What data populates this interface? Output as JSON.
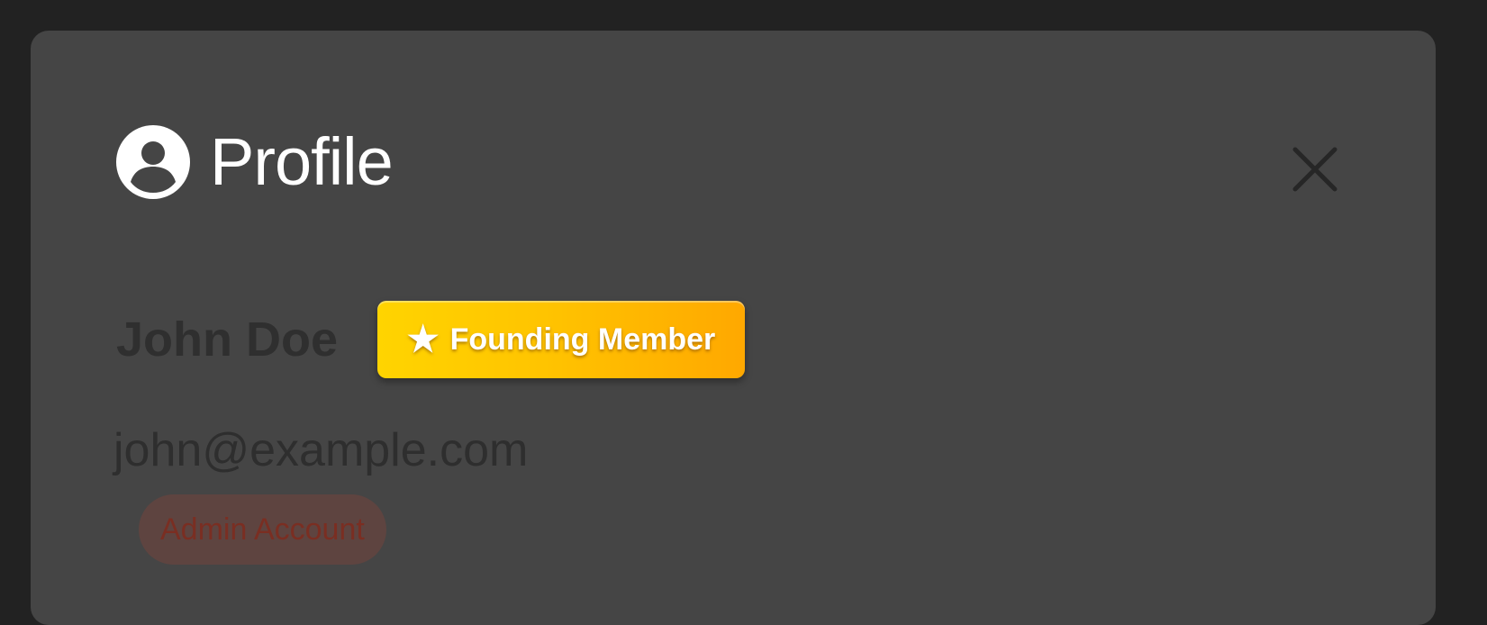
{
  "dialog": {
    "title": "Profile",
    "title_icon": "account-circle-icon",
    "close_icon": "close-icon"
  },
  "user": {
    "name": "John Doe",
    "email": "john@example.com",
    "founding_badge": {
      "icon": "star-icon",
      "label": "Founding Member",
      "color_start": "#ffd400",
      "color_end": "#ffa800"
    },
    "role_badge": {
      "label": "Admin Account",
      "background": "#5e4440",
      "text_color": "#7a2e22"
    }
  },
  "colors": {
    "page_background": "#222222",
    "dialog_background": "#454545"
  }
}
